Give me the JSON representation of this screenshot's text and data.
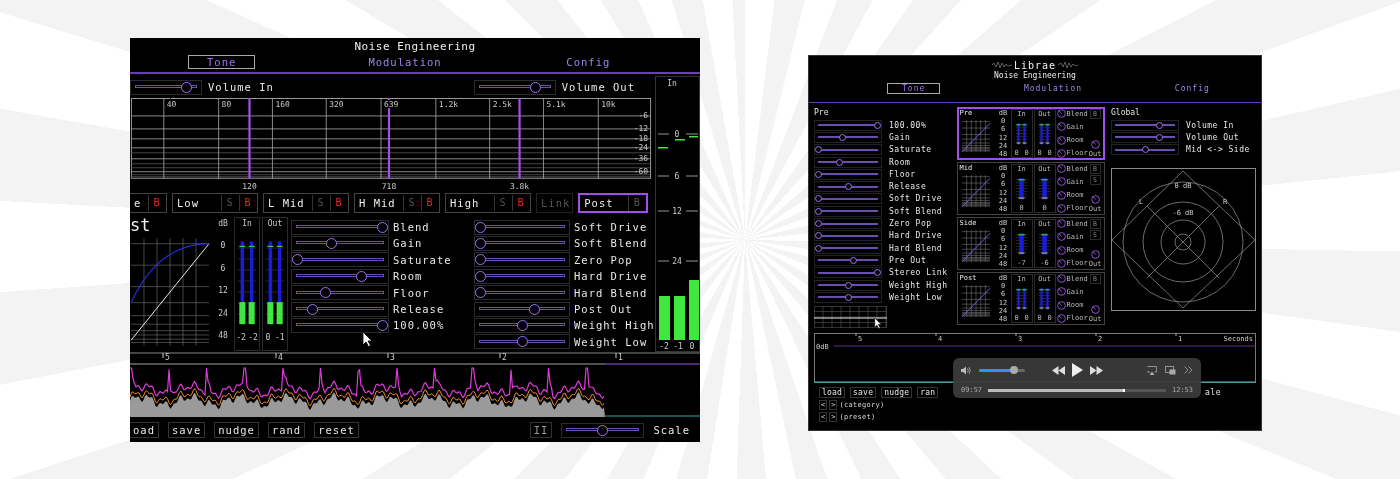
{
  "left_window": {
    "logo": "Noise Engineering",
    "tabs": [
      {
        "label": "Tone",
        "selected": true
      },
      {
        "label": "Modulation",
        "selected": false
      },
      {
        "label": "Config",
        "selected": false
      }
    ],
    "volume_sliders": [
      {
        "label": "Volume In",
        "level": 0.85
      },
      {
        "label": "Volume Out",
        "level": 0.8
      }
    ],
    "eq": {
      "freq_labels": [
        "40",
        "80",
        "160",
        "320",
        "639",
        "1.2k",
        "2.5k",
        "5.1k",
        "10k"
      ],
      "db_labels": [
        "-6",
        "-12",
        "-18",
        "-24",
        "-36",
        "-60"
      ],
      "band_labels": [
        "120",
        "718",
        "3.8k"
      ]
    },
    "meter_column": {
      "title": "In",
      "scale": [
        "0",
        "6",
        "12",
        "24"
      ],
      "readings": [
        "-2",
        "-1",
        "0"
      ]
    },
    "band_buttons": [
      {
        "label": "e",
        "toggles": [
          {
            "text": "B",
            "on": true
          }
        ],
        "selected": false,
        "disabled": false
      },
      {
        "label": "Low",
        "toggles": [
          {
            "text": "S",
            "on": false
          },
          {
            "text": "B",
            "on": true
          }
        ],
        "selected": false,
        "disabled": false
      },
      {
        "label": "L Mid",
        "toggles": [
          {
            "text": "S",
            "on": false
          },
          {
            "text": "B",
            "on": true
          }
        ],
        "selected": false,
        "disabled": false
      },
      {
        "label": "H Mid",
        "toggles": [
          {
            "text": "S",
            "on": false
          },
          {
            "text": "B",
            "on": true
          }
        ],
        "selected": false,
        "disabled": false
      },
      {
        "label": "High",
        "toggles": [
          {
            "text": "S",
            "on": false
          },
          {
            "text": "B",
            "on": true
          }
        ],
        "selected": false,
        "disabled": false
      },
      {
        "label": "Link",
        "selected": false,
        "disabled": true
      },
      {
        "label": "Post",
        "toggles": [
          {
            "text": "B",
            "on": false
          }
        ],
        "selected": true,
        "disabled": false
      }
    ],
    "section": {
      "title": "st",
      "db_labels": [
        "dB",
        "0",
        "6",
        "12",
        "24",
        "48"
      ],
      "meters": [
        {
          "title": "In",
          "readings": [
            "-2",
            "-2"
          ]
        },
        {
          "title": "Out",
          "readings": [
            "0",
            "-1"
          ]
        }
      ]
    },
    "sliders_a": [
      {
        "label": "Blend",
        "level": 1
      },
      {
        "label": "Gain",
        "level": 0.4
      },
      {
        "label": "Saturate",
        "level": 0
      },
      {
        "label": "Room",
        "level": 0.75
      },
      {
        "label": "Floor",
        "level": 0.33
      },
      {
        "label": "Release",
        "level": 0.18
      },
      {
        "label": "100.00%",
        "level": 1
      }
    ],
    "sliders_b": [
      {
        "label": "Soft Drive",
        "level": 0
      },
      {
        "label": "Soft Blend",
        "level": 0
      },
      {
        "label": "Zero Pop",
        "level": 0
      },
      {
        "label": "Hard Drive",
        "level": 0
      },
      {
        "label": "Hard Blend",
        "level": 0
      },
      {
        "label": "Post Out",
        "level": 0.65
      },
      {
        "label": "Weight High",
        "level": 0.5
      },
      {
        "label": "Weight Low",
        "level": 0.5
      }
    ],
    "timeline": {
      "labels": [
        "5",
        "4",
        "3",
        "2",
        "1"
      ]
    },
    "buttons": [
      "oad",
      "save",
      "nudge",
      "rand",
      "reset"
    ],
    "pause_label": "II",
    "scale_slider": {
      "label": "Scale",
      "level": 0.5
    }
  },
  "right_window": {
    "title": "Librae",
    "logo": "Noise Engineering",
    "tabs": [
      {
        "label": "Tone",
        "selected": true
      },
      {
        "label": "Modulation",
        "selected": false
      },
      {
        "label": "Config",
        "selected": false
      }
    ],
    "pre": {
      "title": "Pre",
      "sliders": [
        {
          "label": "100.00%",
          "level": 1
        },
        {
          "label": "Gain",
          "level": 0.4
        },
        {
          "label": "Saturate",
          "level": 0
        },
        {
          "label": "Room",
          "level": 0.35
        },
        {
          "label": "Floor",
          "level": 0
        },
        {
          "label": "Release",
          "level": 0.5
        },
        {
          "label": "Soft Drive",
          "level": 0
        },
        {
          "label": "Soft Blend",
          "level": 0
        },
        {
          "label": "Zero Pop",
          "level": 0
        },
        {
          "label": "Hard Drive",
          "level": 0
        },
        {
          "label": "Hard Blend",
          "level": 0
        },
        {
          "label": "Pre Out",
          "level": 0.6
        },
        {
          "label": "Stereo Link",
          "level": 1
        },
        {
          "label": "Weight High",
          "level": 0.5
        },
        {
          "label": "Weight Low",
          "level": 0.5
        }
      ]
    },
    "bands": [
      {
        "name": "Pre",
        "selected": true,
        "db_labels": [
          "dB",
          "0",
          "6",
          "12",
          "24",
          "48"
        ],
        "meters": [
          {
            "title": "In",
            "readings": [
              "0",
              "0"
            ]
          },
          {
            "title": "Out",
            "readings": [
              "0",
              "0"
            ]
          }
        ],
        "knobs": [
          "Blend",
          "Gain",
          "Room",
          "Floor"
        ],
        "toggles": [
          {
            "text": "B",
            "on": false
          }
        ],
        "out_knob": "Out"
      },
      {
        "name": "Mid",
        "selected": false,
        "db_labels": [
          "dB",
          "0",
          "6",
          "12",
          "24",
          "48"
        ],
        "meters": [
          {
            "title": "In",
            "readings": [
              "0"
            ]
          },
          {
            "title": "Out",
            "readings": [
              "0"
            ]
          }
        ],
        "knobs": [
          "Blend",
          "Gain",
          "Room",
          "Floor"
        ],
        "toggles": [
          {
            "text": "B",
            "on": false
          },
          {
            "text": "S",
            "on": false
          }
        ],
        "out_knob": "Out"
      },
      {
        "name": "Side",
        "selected": false,
        "db_labels": [
          "dB",
          "0",
          "6",
          "12",
          "24",
          "48"
        ],
        "meters": [
          {
            "title": "In",
            "readings": [
              "-7"
            ]
          },
          {
            "title": "Out",
            "readings": [
              "-6"
            ]
          }
        ],
        "knobs": [
          "Blend",
          "Gain",
          "Room",
          "Floor"
        ],
        "toggles": [
          {
            "text": "B",
            "on": false
          },
          {
            "text": "S",
            "on": false
          }
        ],
        "out_knob": "Out"
      },
      {
        "name": "Post",
        "selected": false,
        "db_labels": [
          "dB",
          "0",
          "6",
          "12",
          "24",
          "48"
        ],
        "meters": [
          {
            "title": "In",
            "readings": [
              "0",
              "0"
            ]
          },
          {
            "title": "Out",
            "readings": [
              "0",
              "0"
            ]
          }
        ],
        "knobs": [
          "Blend",
          "Gain",
          "Room",
          "Floor"
        ],
        "toggles": [
          {
            "text": "B",
            "on": false
          }
        ],
        "out_knob": "Out"
      }
    ],
    "global": {
      "title": "Global",
      "sliders": [
        {
          "label": "Volume In",
          "level": 0.75
        },
        {
          "label": "Volume Out",
          "level": 0.75
        },
        {
          "label": "Mid <-> Side",
          "level": 0.5
        }
      ],
      "scope_labels": [
        "0 dB",
        "L",
        "R",
        "-6 dB"
      ]
    },
    "timeline": {
      "labels": [
        "5",
        "4",
        "3",
        "2",
        "1"
      ],
      "unit": "Seconds",
      "level_label": "0dB"
    },
    "buttons": [
      "load",
      "save",
      "nudge",
      "ran"
    ],
    "scale_fragment": "ale",
    "nav_rows": [
      {
        "prev": "<",
        "next": ">",
        "label": "(category)"
      },
      {
        "prev": "<",
        "next": ">",
        "label": "(preset)"
      }
    ],
    "video_controls": {
      "volume": {
        "level": 0.85
      },
      "progress": {
        "level": 0.77
      },
      "elapsed": "09:57",
      "remaining": "12:53"
    }
  }
}
